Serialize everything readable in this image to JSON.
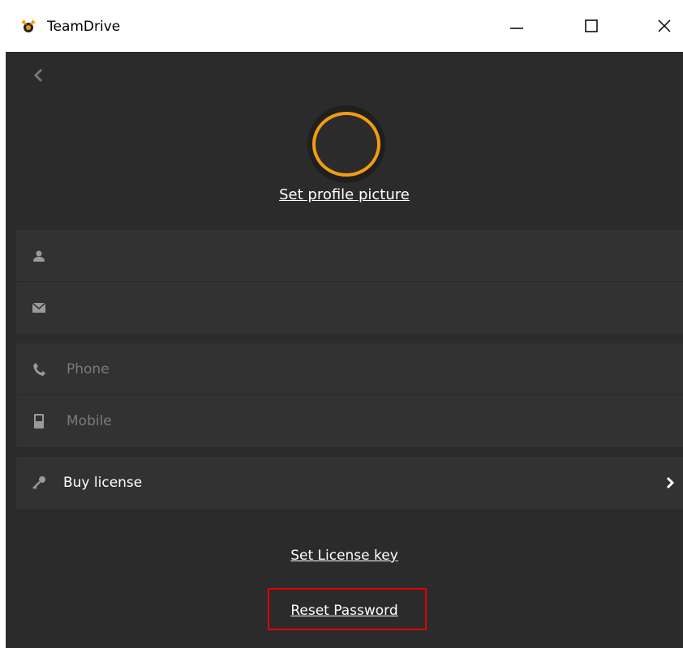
{
  "window": {
    "title": "TeamDrive",
    "controls": {
      "minimize_icon": "minimize-icon",
      "maximize_icon": "maximize-icon",
      "close_icon": "close-icon"
    }
  },
  "colors": {
    "background": "#2b2b2b",
    "panel": "#323232",
    "accent": "#f39c12",
    "highlight_box": "#e00000"
  },
  "profile": {
    "set_picture_label": "Set profile picture"
  },
  "fields": {
    "name": {
      "icon": "person-icon",
      "value": "",
      "placeholder": ""
    },
    "email": {
      "icon": "envelope-icon",
      "value": "",
      "placeholder": ""
    },
    "phone": {
      "icon": "phone-icon",
      "value": "",
      "placeholder": "Phone"
    },
    "mobile": {
      "icon": "mobile-icon",
      "value": "",
      "placeholder": "Mobile"
    }
  },
  "license": {
    "icon": "key-icon",
    "buy_label": "Buy license",
    "set_key_label": "Set License key"
  },
  "actions": {
    "reset_password_label": "Reset Password"
  }
}
